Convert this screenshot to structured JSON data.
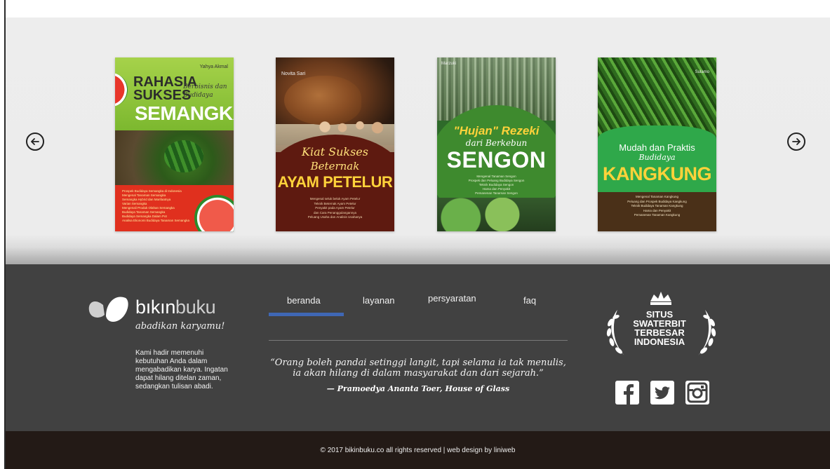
{
  "carousel": {
    "prev_icon": "arrow-left-circle-icon",
    "next_icon": "arrow-right-circle-icon",
    "books": [
      {
        "author": "Yahya Akmal",
        "title_line1": "RAHASIA",
        "title_line2": "SUKSES",
        "subtitle": "Berbisnis dan Budidaya",
        "title_main": "SEMANGKA",
        "contents": [
          "Prospek Budidaya Semangka di Indonesia",
          "Mengenal Tanaman Semangka",
          "Semangka Hybrid dan Manfaatnya",
          "Varian Semangka",
          "Mengenali Produk Olahan Semangka",
          "Budidaya Tanaman Semangka",
          "Budidaya Semangka Dalam Pot",
          "Analisa Ekonomi Budidaya Tanaman Semangka"
        ]
      },
      {
        "author": "Novita Sari",
        "title_line1": "Kiat Sukses",
        "title_line2": "Beternak",
        "title_main": "AYAM PETELUR",
        "contents": [
          "Mengenal seluk beluk Ayam Petelur",
          "Teknik Beternak Ayam Petelur",
          "Penyakit pada Ayam Petelur",
          "dan Cara Penanggulangannya",
          "Peluang Usaha dan Analisis Usahanya"
        ]
      },
      {
        "author": "Marzuki",
        "title_line1": "\"Hujan\" Rezeki",
        "title_line2": "dari Berkebun",
        "title_main": "SENGON",
        "contents": [
          "Mengenal Tanaman Sengon",
          "Prospek dan Peluang Budidaya Sengon",
          "Teknik Budidaya Sengon",
          "Hama dan Penyakit",
          "Pemanenan Tanaman Sengon"
        ]
      },
      {
        "author": "Sulamo",
        "title_line1": "Mudah dan Praktis",
        "title_line2": "Budidaya",
        "title_main": "KANGKUNG",
        "contents": [
          "Mengenal Tanaman Kangkung",
          "Peluang dan Prospek Budidaya Kangkung",
          "Teknik Budidaya Tanaman Kangkung",
          "Hama dan Penyakit",
          "Pemanenan Tanaman Kangkung"
        ]
      }
    ]
  },
  "footer": {
    "logo_bold": "bıkın",
    "logo_light": "buku",
    "tagline": "abadikan karyamu!",
    "about": "Kami hadir memenuhi kebutuhan Anda dalam mengabadikan karya. Ingatan dapat hilang ditelan zaman, sedangkan tulisan abadi.",
    "nav": [
      "beranda",
      "layanan",
      "persyaratan",
      "faq"
    ],
    "active_nav": "beranda",
    "quote": "“Orang boleh pandai setinggi langit, tapi selama ia tak menulis, ia akan hilang di dalam masyarakat dan dari sejarah.”",
    "quote_author": "— Pramoedya Ananta Toer, House of Glass",
    "award_lines": [
      "SITUS",
      "SWATERBIT",
      "TERBESAR",
      "INDONESIA"
    ],
    "social": [
      "facebook-icon",
      "twitter-icon",
      "instagram-icon"
    ],
    "accent_color": "#3f67b5"
  },
  "bottom": {
    "copyright": "© 2017 bikinbuku.co all rights reserved | web design by liniweb"
  }
}
